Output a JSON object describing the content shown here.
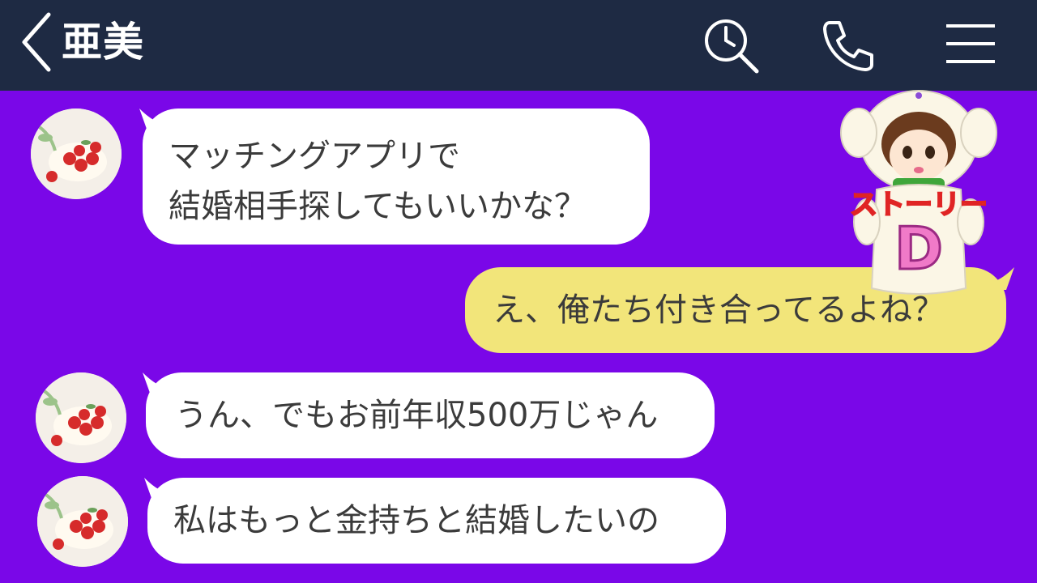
{
  "header": {
    "title": "亜美",
    "back_icon": "chevron-left-icon",
    "search_icon": "search-clock-icon",
    "call_icon": "phone-icon",
    "menu_icon": "hamburger-menu-icon",
    "bg_color": "#1e2a43"
  },
  "chat": {
    "bg_color": "#7a07e8",
    "messages": [
      {
        "sender": "亜美",
        "direction": "incoming",
        "lines": [
          "マッチングアプリで",
          "結婚相手探してもいいかな？"
        ]
      },
      {
        "sender": "me",
        "direction": "outgoing",
        "lines": [
          "え、俺たち付き合ってるよね？"
        ]
      },
      {
        "sender": "亜美",
        "direction": "incoming",
        "lines": [
          "うん、でもお前年収500万じゃん"
        ]
      },
      {
        "sender": "亜美",
        "direction": "incoming",
        "lines": [
          "私はもっと金持ちと結婚したいの"
        ]
      }
    ]
  },
  "sticker": {
    "label": "ストーリーD",
    "icon": "girl-in-sheep-costume-sticker"
  },
  "colors": {
    "incoming_bubble": "#ffffff",
    "outgoing_bubble": "#f2e57a"
  }
}
